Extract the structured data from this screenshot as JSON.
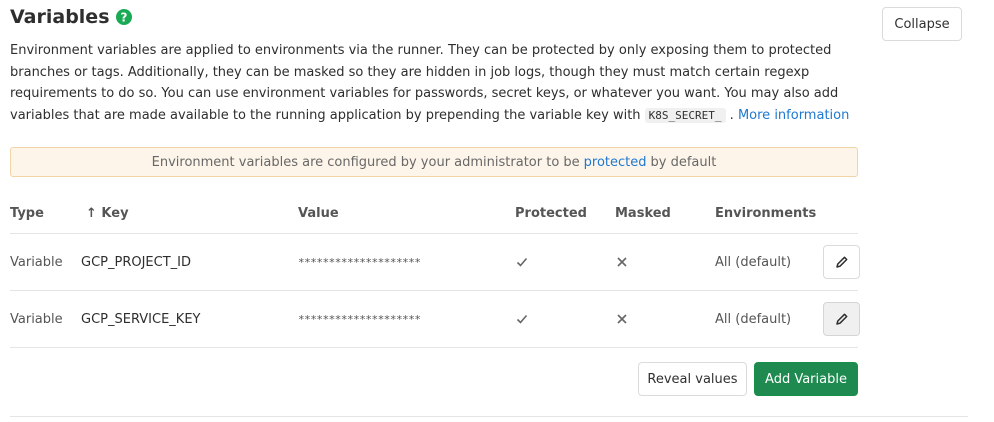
{
  "section": {
    "title": "Variables",
    "collapse_label": "Collapse"
  },
  "description": {
    "text": "Environment variables are applied to environments via the runner. They can be protected by only exposing them to protected branches or tags. Additionally, they can be masked so they are hidden in job logs, though they must match certain regexp requirements to do so. You can use environment variables for passwords, secret keys, or whatever you want. You may also add variables that are made available to the running application by prepending the variable key with",
    "code": "K8S_SECRET_",
    "after_code": ".",
    "link": "More information"
  },
  "alert": {
    "before": "Environment variables are configured by your administrator to be",
    "link": "protected",
    "after": "by default"
  },
  "table": {
    "headers": {
      "type": "Type",
      "key": "↑ Key",
      "value": "Value",
      "protected": "Protected",
      "masked": "Masked",
      "environments": "Environments"
    },
    "rows": [
      {
        "type": "Variable",
        "key": "GCP_PROJECT_ID",
        "value": "********************",
        "protected": "check-icon",
        "masked": "close-icon",
        "environment": "All (default)"
      },
      {
        "type": "Variable",
        "key": "GCP_SERVICE_KEY",
        "value": "********************",
        "protected": "check-icon",
        "masked": "close-icon",
        "environment": "All (default)"
      }
    ]
  },
  "actions": {
    "reveal_label": "Reveal values",
    "add_label": "Add Variable"
  },
  "colors": {
    "help_icon": "#1aaa55",
    "link": "#1f78d1",
    "primary_button": "#1e8a4f",
    "alert_background": "#fdf5ea",
    "alert_border": "#f2d5a7"
  }
}
